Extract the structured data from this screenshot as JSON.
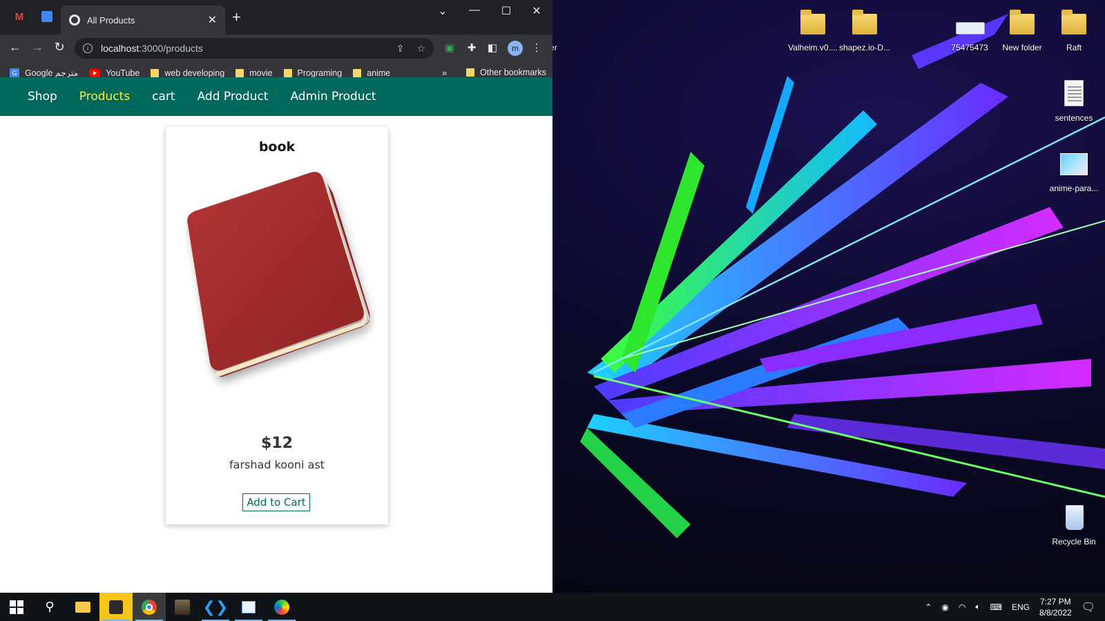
{
  "browser": {
    "tab_title": "All Products",
    "url_host": "localhost",
    "url_path": ":3000/products",
    "profile_initial": "m",
    "bookmarks": [
      {
        "label": "Google مترجم",
        "icon": "google-translate-icon"
      },
      {
        "label": "YouTube",
        "icon": "youtube-icon"
      },
      {
        "label": "web developing",
        "icon": "folder-icon"
      },
      {
        "label": "movie",
        "icon": "folder-icon"
      },
      {
        "label": "Programing",
        "icon": "folder-icon"
      },
      {
        "label": "anime",
        "icon": "folder-icon"
      }
    ],
    "bookmarks_overflow": "»",
    "other_bookmarks": "Other bookmarks"
  },
  "site": {
    "nav": [
      {
        "label": "Shop",
        "active": false
      },
      {
        "label": "Products",
        "active": true
      },
      {
        "label": "cart",
        "active": false
      },
      {
        "label": "Add Product",
        "active": false
      },
      {
        "label": "Admin Product",
        "active": false
      }
    ],
    "header_color": "#00695c",
    "active_color": "#ffeb3b"
  },
  "product": {
    "title": "book",
    "price": "$12",
    "description": "farshad kooni ast",
    "button_label": "Add to Cart",
    "image_icon": "book-icon",
    "book_color": "#a32b2b"
  },
  "desktop": {
    "icons": [
      {
        "label": "older\n)",
        "type": "folder"
      },
      {
        "label": "Valheim.v0....",
        "type": "zip-folder"
      },
      {
        "label": "shapez.io-D...",
        "type": "zip-folder"
      },
      {
        "label": "75475473",
        "type": "keyboard-file"
      },
      {
        "label": "New folder",
        "type": "folder"
      },
      {
        "label": "Raft",
        "type": "zip-folder"
      },
      {
        "label": "sentences",
        "type": "text-file"
      },
      {
        "label": "anime-para...",
        "type": "image-file"
      },
      {
        "label": "Recycle Bin",
        "type": "recycle-bin"
      }
    ]
  },
  "taskbar": {
    "apps": [
      "windows-start-icon",
      "search-icon",
      "file-explorer-icon",
      "sticky-app-icon",
      "chrome-icon",
      "game-app-icon",
      "vscode-icon",
      "notepad-icon",
      "paint-icon"
    ],
    "language": "ENG",
    "time": "7:27 PM",
    "date": "8/8/2022"
  }
}
